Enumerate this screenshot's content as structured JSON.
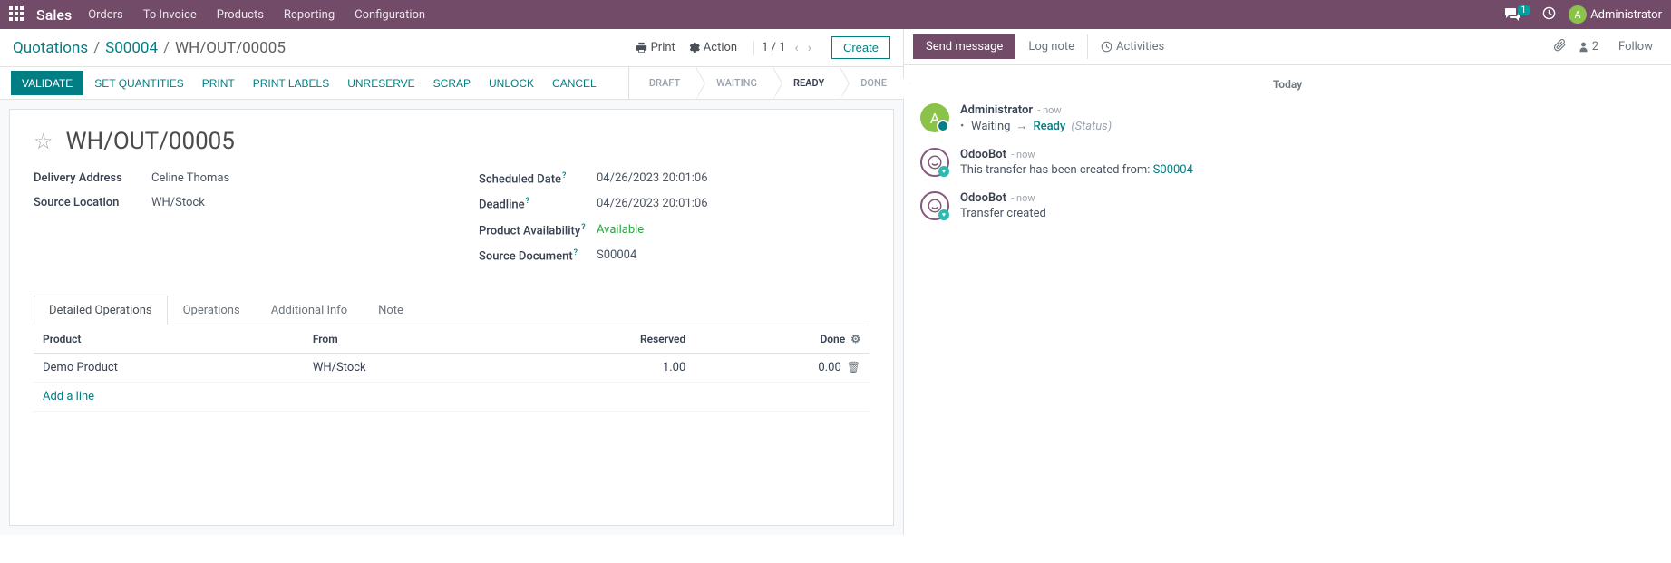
{
  "navbar": {
    "brand": "Sales",
    "menu": [
      "Orders",
      "To Invoice",
      "Products",
      "Reporting",
      "Configuration"
    ],
    "msg_count": "1",
    "user_initial": "A",
    "user_name": "Administrator"
  },
  "breadcrumb": {
    "items": [
      "Quotations",
      "S00004"
    ],
    "current": "WH/OUT/00005"
  },
  "ctrl": {
    "print": "Print",
    "action": "Action",
    "pager": "1 / 1",
    "create": "Create"
  },
  "statusbar": {
    "validate": "VALIDATE",
    "buttons": [
      "SET QUANTITIES",
      "PRINT",
      "PRINT LABELS",
      "UNRESERVE",
      "SCRAP",
      "UNLOCK",
      "CANCEL"
    ],
    "steps": [
      "DRAFT",
      "WAITING",
      "READY",
      "DONE"
    ],
    "active_step": 2
  },
  "form": {
    "title": "WH/OUT/00005",
    "left": {
      "delivery_address_label": "Delivery Address",
      "delivery_address": "Celine Thomas",
      "source_location_label": "Source Location",
      "source_location": "WH/Stock"
    },
    "right": {
      "scheduled_date_label": "Scheduled Date",
      "scheduled_date": "04/26/2023 20:01:06",
      "deadline_label": "Deadline",
      "deadline": "04/26/2023 20:01:06",
      "availability_label": "Product Availability",
      "availability": "Available",
      "source_doc_label": "Source Document",
      "source_doc": "S00004"
    }
  },
  "tabs": [
    "Detailed Operations",
    "Operations",
    "Additional Info",
    "Note"
  ],
  "table": {
    "headers": {
      "product": "Product",
      "from": "From",
      "reserved": "Reserved",
      "done": "Done"
    },
    "rows": [
      {
        "product": "Demo Product",
        "from": "WH/Stock",
        "reserved": "1.00",
        "done": "0.00"
      }
    ],
    "add_line": "Add a line"
  },
  "chatter": {
    "send": "Send message",
    "log": "Log note",
    "activities": "Activities",
    "follower_count": "2",
    "follow": "Follow",
    "date": "Today",
    "messages": [
      {
        "type": "admin",
        "author": "Administrator",
        "time": "now",
        "tracking": {
          "old": "Waiting",
          "new": "Ready",
          "field": "(Status)"
        }
      },
      {
        "type": "bot",
        "author": "OdooBot",
        "time": "now",
        "body_prefix": "This transfer has been created from: ",
        "body_link": "S00004"
      },
      {
        "type": "bot",
        "author": "OdooBot",
        "time": "now",
        "body": "Transfer created"
      }
    ]
  }
}
